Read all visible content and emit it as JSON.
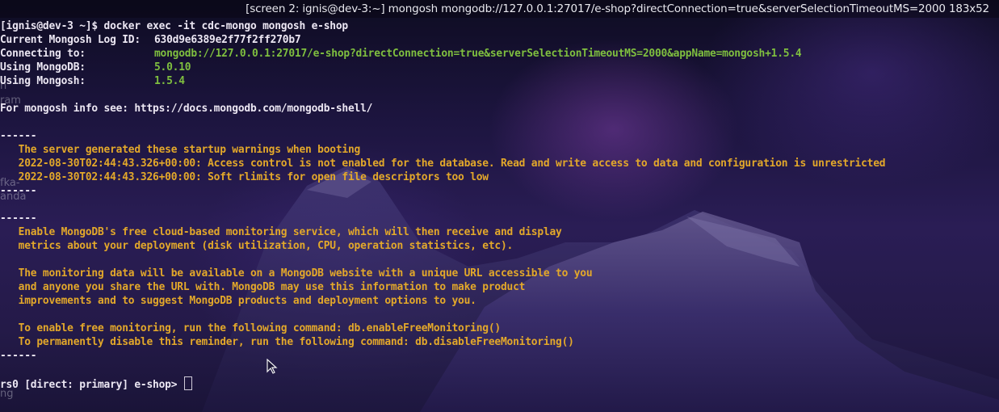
{
  "window": {
    "title": "[screen 2: ignis@dev-3:~] mongosh mongodb://127.0.0.1:27017/e-shop?directConnection=true&serverSelectionTimeoutMS=2000 183x52"
  },
  "desktop_ghost_labels": [
    "n",
    "ram",
    "fka-",
    "anda",
    "ng"
  ],
  "terminal": {
    "command_line": "[ignis@dev-3 ~]$ docker exec -it cdc-mongo mongosh e-shop",
    "log_id_label": "Current Mongosh Log ID:",
    "log_id_value": "630d9e6389e2f77f2ff270b7",
    "connecting_label": "Connecting to:",
    "connecting_value": "mongodb://127.0.0.1:27017/e-shop?directConnection=true&serverSelectionTimeoutMS=2000&appName=mongosh+1.5.4",
    "mongodb_label": "Using MongoDB:",
    "mongodb_value": "5.0.10",
    "mongosh_label": "Using Mongosh:",
    "mongosh_value": "1.5.4",
    "info_line": "For mongosh info see: https://docs.mongodb.com/mongodb-shell/",
    "separator": "------",
    "warnings_header": "   The server generated these startup warnings when booting",
    "warning_1": "   2022-08-30T02:44:43.326+00:00: Access control is not enabled for the database. Read and write access to data and configuration is unrestricted",
    "warning_2": "   2022-08-30T02:44:43.326+00:00: Soft rlimits for open file descriptors too low",
    "monitoring_lines": [
      "   Enable MongoDB's free cloud-based monitoring service, which will then receive and display",
      "   metrics about your deployment (disk utilization, CPU, operation statistics, etc).",
      "",
      "   The monitoring data will be available on a MongoDB website with a unique URL accessible to you",
      "   and anyone you share the URL with. MongoDB may use this information to make product",
      "   improvements and to suggest MongoDB products and deployment options to you.",
      "",
      "   To enable free monitoring, run the following command: db.enableFreeMonitoring()",
      "   To permanently disable this reminder, run the following command: db.disableFreeMonitoring()"
    ],
    "prompt": "rs0 [direct: primary] e-shop> "
  },
  "colors": {
    "text": "#ece7f3",
    "url": "#7fbf3f",
    "warning": "#e3a82a"
  }
}
